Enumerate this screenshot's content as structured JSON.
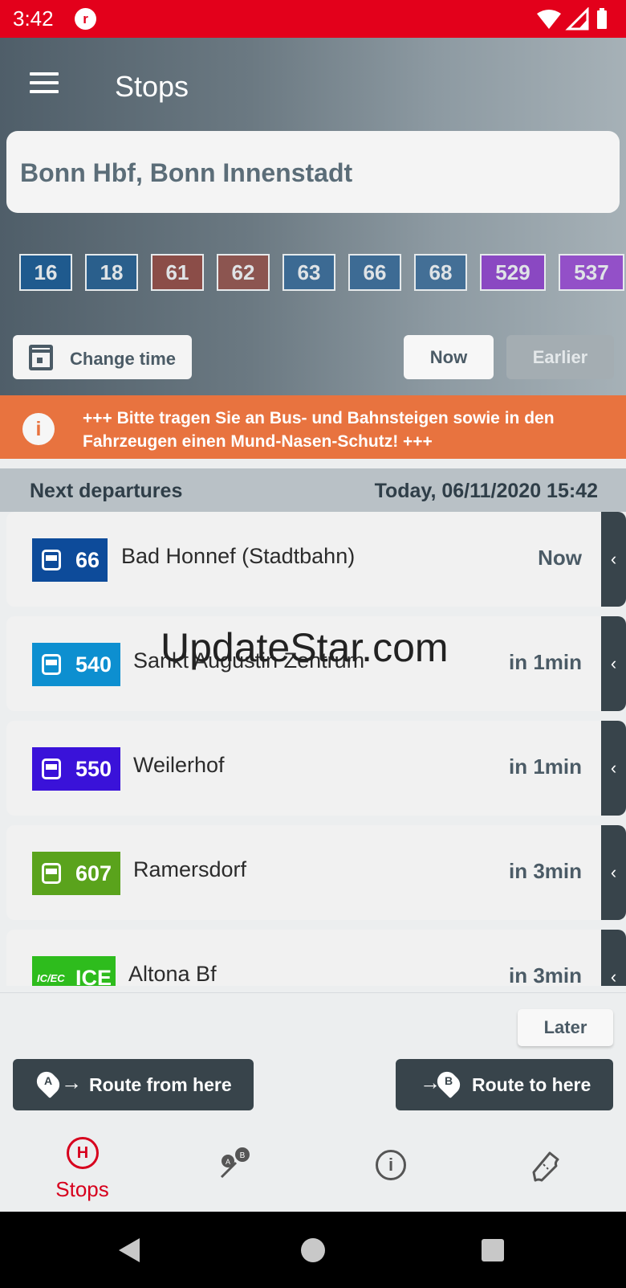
{
  "status_bar": {
    "time": "3:42"
  },
  "header": {
    "title": "Stops",
    "search_value": "Bonn Hbf, Bonn Innenstadt"
  },
  "lines": [
    {
      "label": "16",
      "color": "#1f5a8e"
    },
    {
      "label": "18",
      "color": "#2a5f8c"
    },
    {
      "label": "61",
      "color": "#8b4d48"
    },
    {
      "label": "62",
      "color": "#8c5550"
    },
    {
      "label": "63",
      "color": "#3c6a93"
    },
    {
      "label": "66",
      "color": "#3d6b94"
    },
    {
      "label": "68",
      "color": "#436f96"
    },
    {
      "label": "529",
      "color": "#8a48c2"
    },
    {
      "label": "537",
      "color": "#9350c8"
    }
  ],
  "controls": {
    "change_time": "Change time",
    "now": "Now",
    "earlier": "Earlier",
    "later": "Later"
  },
  "notice": {
    "text": "+++ Bitte tragen Sie an Bus- und Bahnsteigen sowie in den Fahrzeugen einen Mund-Nasen-Schutz! +++"
  },
  "departures_header": {
    "title": "Next departures",
    "datetime": "Today, 06/11/2020 15:42"
  },
  "departures": [
    {
      "line": "66",
      "destination": "Bad Honnef (Stadtbahn)",
      "time": "Now",
      "color": "#0d4b9a",
      "vehicle": "tram-icon"
    },
    {
      "line": "540",
      "destination": "Sankt Augustin Zentrum",
      "time": "in 1min",
      "color": "#0d8fd0",
      "vehicle": "bus-icon"
    },
    {
      "line": "550",
      "destination": "Weilerhof",
      "time": "in 1min",
      "color": "#3a12d9",
      "vehicle": "bus-icon"
    },
    {
      "line": "607",
      "destination": "Ramersdorf",
      "time": "in 3min",
      "color": "#5aa31c",
      "vehicle": "bus-icon"
    },
    {
      "line": "ICE",
      "destination": "Altona Bf",
      "time": "in 3min",
      "color": "#2ebc1d",
      "vehicle": "ic-ec-icon",
      "vehicle_text": "IC/EC"
    }
  ],
  "route_buttons": {
    "from": "Route from here",
    "to": "Route to here",
    "from_pin": "A",
    "to_pin": "B"
  },
  "bottom_nav": {
    "stops": "Stops"
  },
  "watermark": "UpdateStar.com"
}
